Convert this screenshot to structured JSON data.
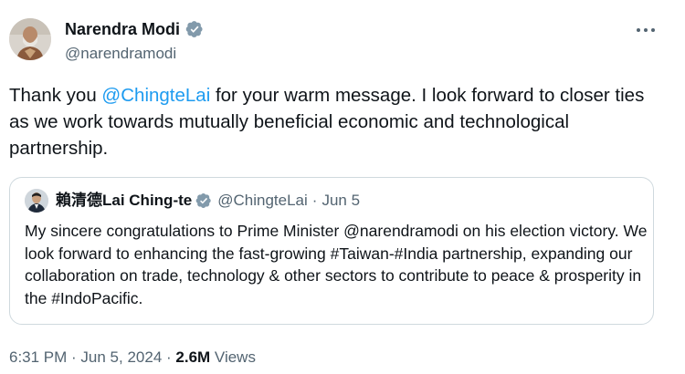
{
  "author": {
    "name": "Narendra Modi",
    "handle": "@narendramodi",
    "avatar_icon": "person-avatar-icon",
    "verified_icon": "verified-badge-icon"
  },
  "more_icon": "more-options-icon",
  "tweet": {
    "prefix": "Thank you ",
    "mention": "@ChingteLai",
    "suffix": " for your warm message. I look forward to closer ties as we work towards mutually beneficial economic and technological partnership."
  },
  "quoted": {
    "name": "賴清德Lai Ching-te",
    "handle": "@ChingteLai",
    "separator": "·",
    "date": "Jun 5",
    "text": "My sincere congratulations to Prime Minister @narendramodi on his election victory. We look forward to enhancing the fast-growing #Taiwan-#India partnership, expanding our collaboration on trade, technology & other sectors to contribute to peace & prosperity in the #IndoPacific."
  },
  "meta": {
    "time": "6:31 PM",
    "dot1": " · ",
    "date": "Jun 5, 2024",
    "dot2": " · ",
    "views_count": "2.6M",
    "views_label": " Views"
  },
  "colors": {
    "accent": "#1d9bf0",
    "muted": "#536471",
    "text": "#0f1419",
    "border": "#cfd9de"
  }
}
